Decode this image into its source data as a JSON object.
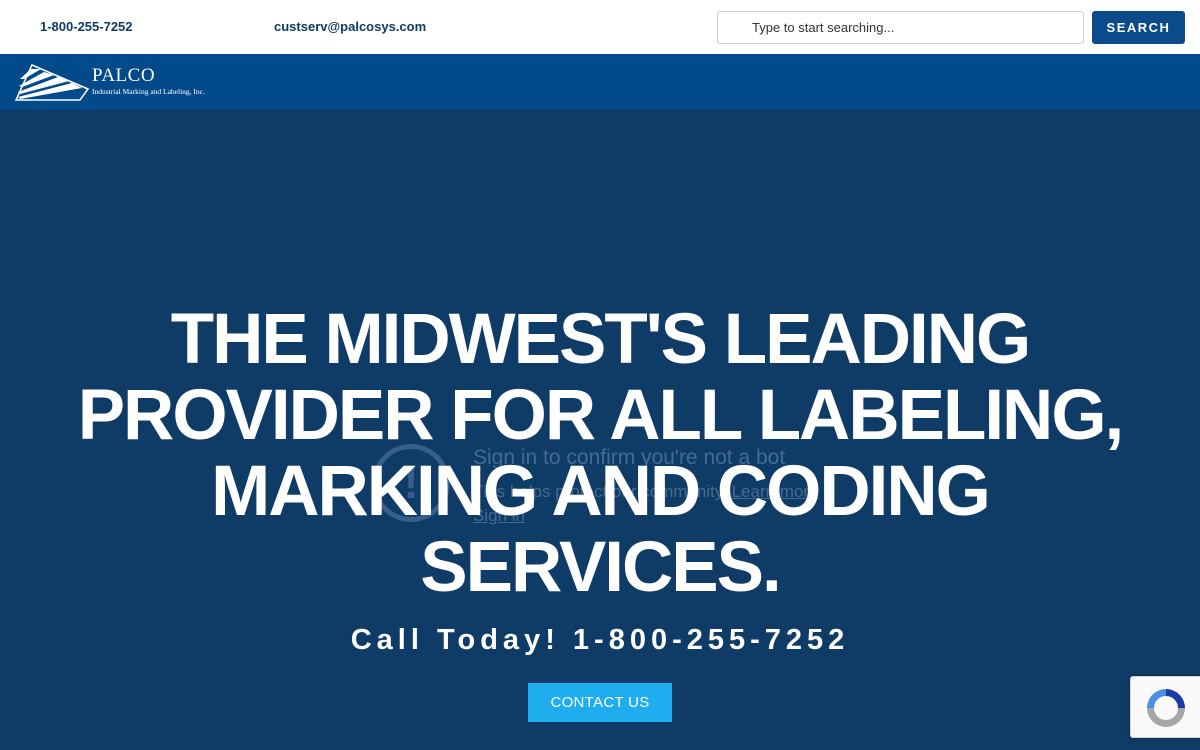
{
  "topbar": {
    "phone": "1-800-255-7252",
    "email": "custserv@palcosys.com",
    "search_placeholder": "Type to start searching...",
    "search_button": "SEARCH"
  },
  "logo": {
    "name": "PALCO",
    "tagline": "Industrial Marking and Labeling, Inc."
  },
  "overlay": {
    "title": "Sign in to confirm you're not a bot",
    "subtitle": "This helps protect our community.",
    "learn_more": "Learn more",
    "sign_in": "Sign in"
  },
  "hero": {
    "headline": "THE MIDWEST'S LEADING PROVIDER FOR ALL LABELING, MARKING AND CODING SERVICES.",
    "callout": "Call Today! 1-800-255-7252",
    "contact_button": "CONTACT US"
  },
  "colors": {
    "hero_bg": "#0f3b67",
    "nav_bg": "#024a8a",
    "search_button": "#0b4b8c",
    "contact_button": "#1eaef0"
  }
}
